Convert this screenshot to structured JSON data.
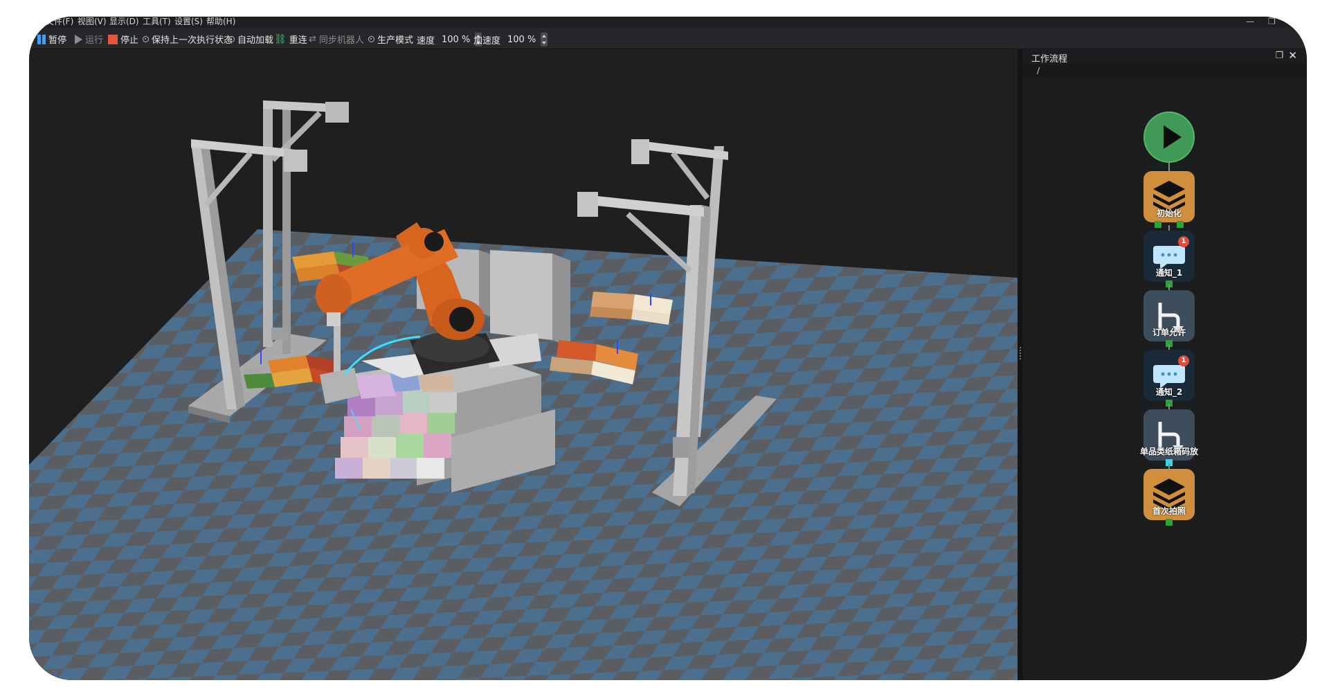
{
  "menu": {
    "items": [
      "文件(F)",
      "视图(V)",
      "显示(D)",
      "工具(T)",
      "设置(S)",
      "帮助(H)"
    ]
  },
  "toolbar": {
    "pause_label": "暂停",
    "run_label": "运行",
    "stop_label": "停止",
    "keep_last_state_label": "保持上一次执行状态",
    "auto_load_label": "自动加载",
    "reconnect_label": "重连",
    "sync_robot_label": "同步机器人",
    "production_mode_label": "生产模式",
    "speed_label": "速度",
    "speed_value": "100 %",
    "accel_label": "加速度",
    "accel_value": "100 %"
  },
  "viewport": {
    "axis_label": "Z"
  },
  "workflow": {
    "title": "工作流程",
    "path": "/",
    "nodes": [
      {
        "label": "初始化",
        "icon": "layers-icon"
      },
      {
        "label": "通知_1",
        "icon": "chat-bubble-icon",
        "badge": "1"
      },
      {
        "label": "订单允许",
        "icon": "branch-arrow-icon"
      },
      {
        "label": "通知_2",
        "icon": "chat-bubble-icon",
        "badge": "1"
      },
      {
        "label": "单品类纸箱码放",
        "icon": "branch-arrow-icon"
      },
      {
        "label": "首次拍照",
        "icon": "layers-icon"
      }
    ]
  },
  "colors": {
    "robot": "#d8651f",
    "floor_blue": "#4b6f8c",
    "floor_gray": "#5a5e63",
    "start_green": "#3f9a55",
    "node_orange": "#d08f3d",
    "trajectory": "#3fe0ff"
  }
}
